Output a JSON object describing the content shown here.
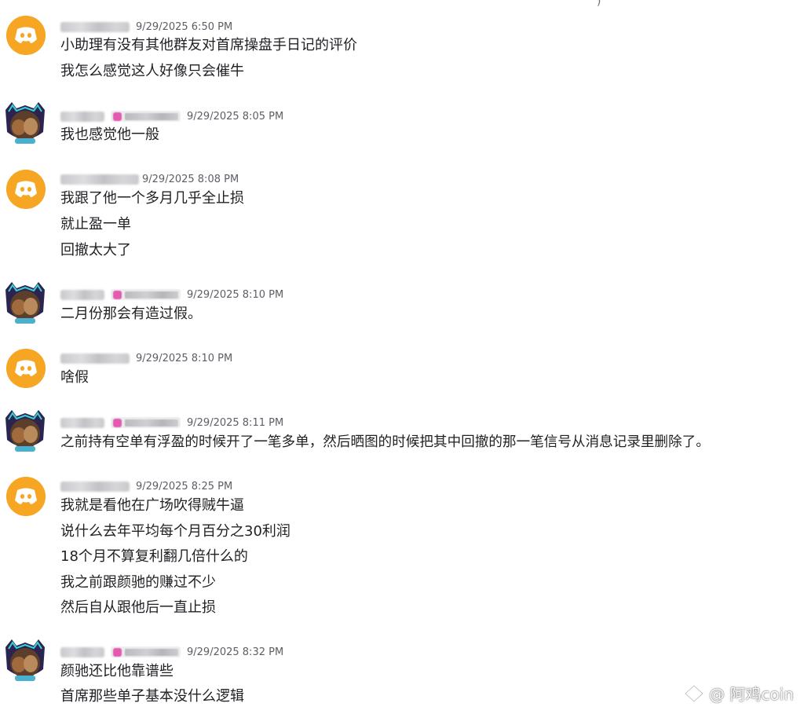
{
  "top_fragment": ")",
  "messages": [
    {
      "avatar": "discord-icon",
      "timestamp": "9/29/2025 6:50 PM",
      "lines": [
        "小助理有没有其他群友对首席操盘手日记的评价",
        "我怎么感觉这人好像只会催牛"
      ]
    },
    {
      "avatar": "user-avatar",
      "timestamp": "9/29/2025 8:05 PM",
      "lines": [
        "我也感觉他一般"
      ]
    },
    {
      "avatar": "discord-icon",
      "timestamp": "9/29/2025 8:08 PM",
      "lines": [
        "我跟了他一个多月几乎全止损",
        "就止盈一单",
        "回撤太大了"
      ]
    },
    {
      "avatar": "user-avatar",
      "timestamp": "9/29/2025 8:10 PM",
      "lines": [
        "二月份那会有造过假。"
      ]
    },
    {
      "avatar": "discord-icon",
      "timestamp": "9/29/2025 8:10 PM",
      "lines": [
        "啥假"
      ]
    },
    {
      "avatar": "user-avatar",
      "timestamp": "9/29/2025 8:11 PM",
      "lines": [
        "之前持有空单有浮盈的时候开了一笔多单，然后晒图的时候把其中回撤的那一笔信号从消息记录里删除了。"
      ]
    },
    {
      "avatar": "discord-icon",
      "timestamp": "9/29/2025 8:25 PM",
      "lines": [
        "我就是看他在广场吹得贼牛逼",
        "说什么去年平均每个月百分之30利润",
        "18个月不算复利翻几倍什么的",
        "我之前跟颜驰的赚过不少",
        "然后自从跟他后一直止损"
      ]
    },
    {
      "avatar": "user-avatar",
      "timestamp": "9/29/2025 8:32 PM",
      "lines": [
        "颜驰还比他靠谱些",
        "首席那些单子基本没什么逻辑"
      ]
    }
  ],
  "watermark": "@ 阿鸡coin",
  "colors": {
    "discord_avatar_bg": "#f6a623",
    "role_dot": "#e35ab0",
    "timestamp": "#5c5e66",
    "text": "#1f2024"
  }
}
